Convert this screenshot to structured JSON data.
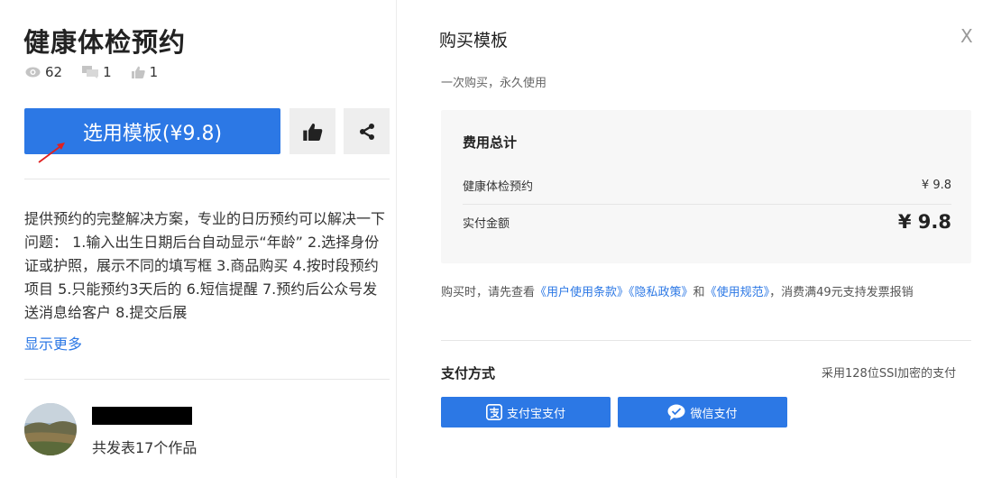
{
  "product": {
    "title": "健康体检预约",
    "views": "62",
    "comments": "1",
    "likes": "1",
    "use_button": "选用模板(¥9.8)",
    "description": "提供预约的完整解决方案，专业的日历预约可以解决一下问题： 1.输入出生日期后台自动显示“年龄” 2.选择身份证或护照，展示不同的填写框 3.商品购买 4.按时段预约项目 5.只能预约3天后的 6.短信提醒 7.预约后公众号发送消息给客户 8.提交后展",
    "show_more": "显示更多"
  },
  "author": {
    "works": "共发表17个作品"
  },
  "purchase": {
    "title": "购买模板",
    "close": "X",
    "subtitle": "一次购买，永久使用",
    "fee_head": "费用总计",
    "item_name": "健康体检预约",
    "item_price": "¥ 9.8",
    "total_label": "实付金额",
    "total_value": "¥ 9.8",
    "notice_prefix": "购买时，请先查看",
    "link_terms": "《用户使用条款》",
    "link_privacy": "《隐私政策》",
    "notice_and": "和",
    "link_rules": "《使用规范》",
    "notice_suffix": "，消费满49元支持发票报销",
    "pay_head": "支付方式",
    "pay_secure": "采用128位SSI加密的支付",
    "alipay": "支付宝支付",
    "wechat": "微信支付"
  },
  "colors": {
    "primary": "#2c78e5",
    "arrow": "#e02020"
  }
}
